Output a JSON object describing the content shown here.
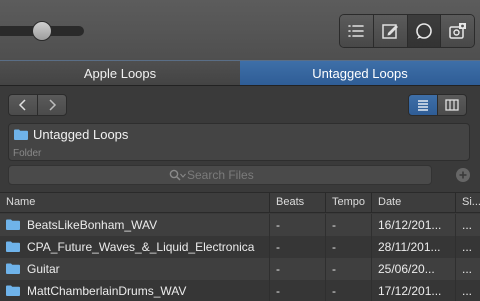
{
  "toolbar": {
    "view_buttons": [
      {
        "icon": "list-icon",
        "active": false
      },
      {
        "icon": "note-edit-icon",
        "active": false
      },
      {
        "icon": "loop-browser-icon",
        "active": true
      },
      {
        "icon": "media-browser-icon",
        "active": false
      }
    ]
  },
  "tabs": [
    {
      "label": "Apple Loops",
      "selected": false
    },
    {
      "label": "Untagged Loops",
      "selected": true
    }
  ],
  "folder": {
    "name": "Untagged Loops",
    "label": "Folder"
  },
  "search": {
    "placeholder": "Search Files",
    "value": ""
  },
  "table": {
    "columns": [
      "Name",
      "Beats",
      "Tempo",
      "Date",
      "Si..."
    ],
    "rows": [
      {
        "name": "BeatsLikeBonham_WAV",
        "beats": "-",
        "tempo": "-",
        "date": "16/12/201...",
        "size": "..."
      },
      {
        "name": "CPA_Future_Waves_&_Liquid_Electronica",
        "beats": "-",
        "tempo": "-",
        "date": "28/11/201...",
        "size": "..."
      },
      {
        "name": "Guitar",
        "beats": "-",
        "tempo": "-",
        "date": "25/06/20...",
        "size": "..."
      },
      {
        "name": "MattChamberlainDrums_WAV",
        "beats": "-",
        "tempo": "-",
        "date": "17/12/201...",
        "size": "..."
      }
    ]
  },
  "colors": {
    "accent": "#3a6aa4",
    "folder": "#6fb3ea"
  }
}
